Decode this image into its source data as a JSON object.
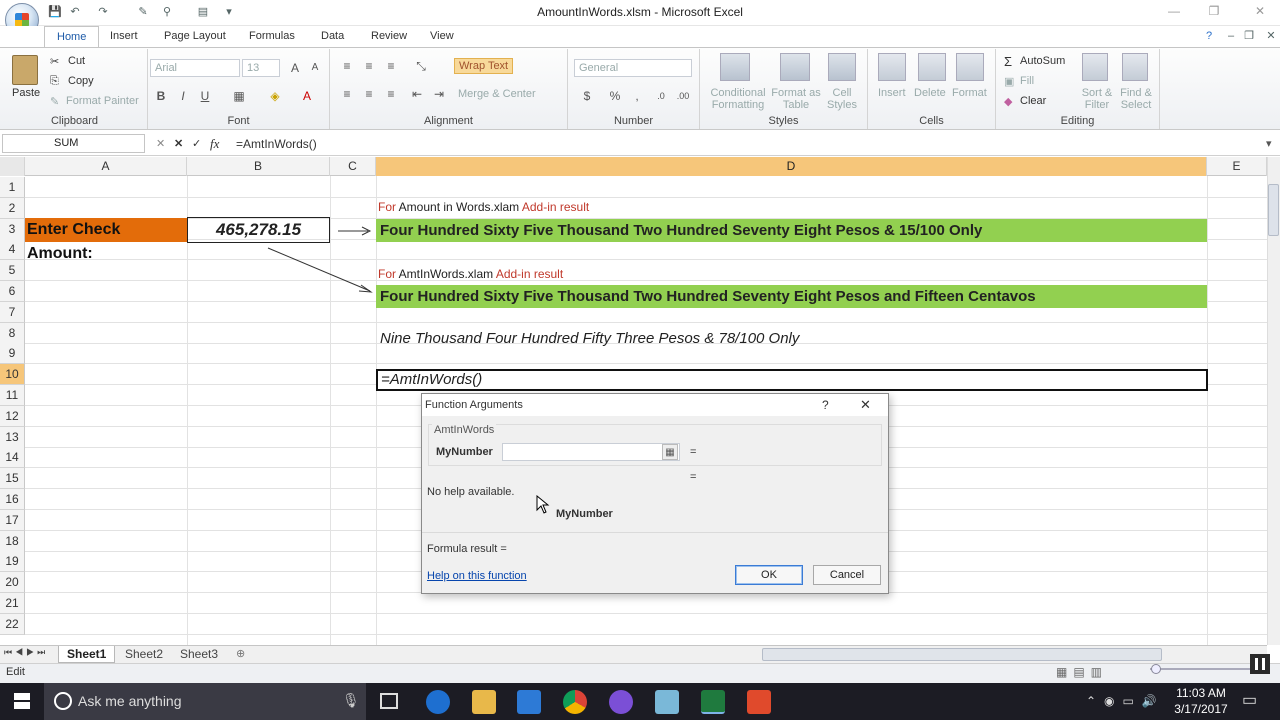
{
  "window": {
    "title": "AmountInWords.xlsm - Microsoft Excel"
  },
  "tabs": [
    "Home",
    "Insert",
    "Page Layout",
    "Formulas",
    "Data",
    "Review",
    "View"
  ],
  "ribbon": {
    "clipboard": {
      "paste": "Paste",
      "cut": "Cut",
      "copy": "Copy",
      "format_painter": "Format Painter",
      "label": "Clipboard"
    },
    "font": {
      "name": "Arial",
      "size": "13",
      "label": "Font"
    },
    "alignment": {
      "wrap": "Wrap Text",
      "merge": "Merge & Center",
      "label": "Alignment"
    },
    "number": {
      "format": "General",
      "label": "Number"
    },
    "styles": {
      "conditional": "Conditional Formatting",
      "format_table": "Format as Table",
      "cell_styles": "Cell Styles",
      "label": "Styles"
    },
    "cells": {
      "insert": "Insert",
      "delete": "Delete",
      "format": "Format",
      "label": "Cells"
    },
    "editing": {
      "autosum": "AutoSum",
      "fill": "Fill",
      "clear": "Clear",
      "sort": "Sort & Filter",
      "find": "Find & Select",
      "label": "Editing"
    }
  },
  "formula_bar": {
    "name_box": "SUM",
    "fx": "fx",
    "formula": "=AmtInWords()"
  },
  "columns": [
    "A",
    "B",
    "C",
    "D",
    "E"
  ],
  "rows": [
    "1",
    "2",
    "3",
    "4",
    "5",
    "6",
    "7",
    "8",
    "9",
    "10",
    "11",
    "12",
    "13",
    "14",
    "15",
    "16",
    "17",
    "18",
    "19",
    "20",
    "21",
    "22"
  ],
  "cells": {
    "A3": "Enter Check Amount:",
    "B3": "465,278.15",
    "D2_for": "For",
    "D2_mid": "Amount in Words.xlam",
    "D2_end": "Add-in result",
    "D3": "Four Hundred Sixty Five Thousand Two Hundred Seventy Eight Pesos & 15/100 Only",
    "D5_for": "For",
    "D5_mid": "AmtInWords.xlam",
    "D5_end": "Add-in result",
    "D6": "Four Hundred Sixty Five Thousand Two Hundred Seventy Eight Pesos and Fifteen Centavos",
    "D8": "Nine Thousand Four Hundred Fifty Three Pesos & 78/100 Only",
    "D10": "=AmtInWords()"
  },
  "colors": {
    "orange": "#e36c0a",
    "green": "#92d050",
    "red_text": "#c0392b",
    "accent": "#1e5ba8"
  },
  "dialog": {
    "title": "Function Arguments",
    "help_glyph": "?",
    "close_glyph": "✕",
    "function_name": "AmtInWords",
    "arg_label": "MyNumber",
    "eq1": "=",
    "eq2": "=",
    "no_help": "No help available.",
    "arg_bold": "MyNumber",
    "formula_result": "Formula result =",
    "help_link": "Help on this function",
    "ok": "OK",
    "cancel": "Cancel"
  },
  "sheets": [
    "Sheet1",
    "Sheet2",
    "Sheet3"
  ],
  "status": {
    "mode": "Edit"
  },
  "taskbar": {
    "search": "Ask me anything",
    "time": "11:03 AM",
    "date": "3/17/2017"
  }
}
